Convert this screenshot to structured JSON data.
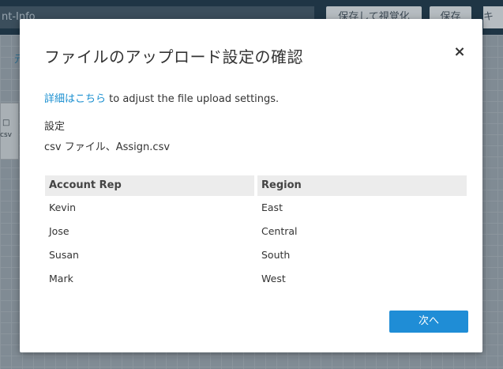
{
  "background": {
    "title_input": "nt-Info",
    "save_visualize_label": "保存して視覚化",
    "save_label": "保存",
    "extra_label": "キ",
    "toolbar_text": "元",
    "node_label": "csv"
  },
  "modal": {
    "title": "ファイルのアップロード設定の確認",
    "close_label": "×",
    "link_text": "詳細はこちら",
    "link_suffix": " to adjust the file upload settings.",
    "settings_label": "設定",
    "settings_value": "csv ファイル、Assign.csv",
    "next_label": "次へ"
  },
  "table": {
    "headers": [
      "Account Rep",
      "Region"
    ],
    "rows": [
      [
        "Kevin",
        "East"
      ],
      [
        "Jose",
        "Central"
      ],
      [
        "Susan",
        "South"
      ],
      [
        "Mark",
        "West"
      ]
    ]
  },
  "colors": {
    "accent": "#1f8dd6",
    "link": "#1a8fd0",
    "header_bg": "#1f3545"
  }
}
